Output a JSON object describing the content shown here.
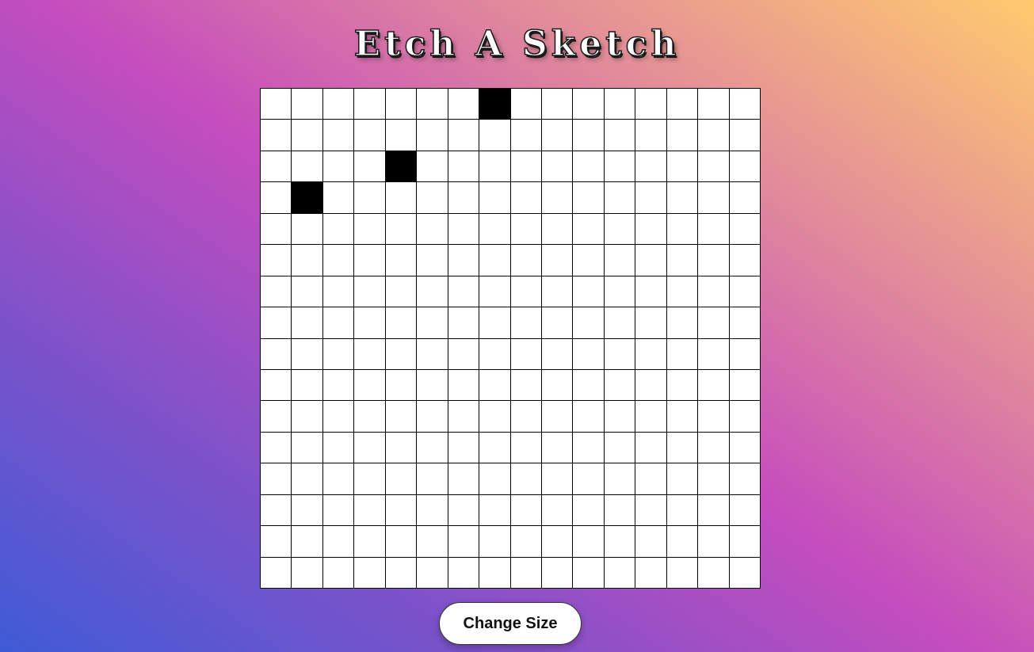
{
  "app": {
    "title": "Etch A Sketch"
  },
  "grid": {
    "rows": 16,
    "cols": 16,
    "filled_cells": [
      {
        "row": 0,
        "col": 7
      },
      {
        "row": 2,
        "col": 4
      },
      {
        "row": 3,
        "col": 1
      }
    ],
    "cell_color": "#ffffff",
    "ink_color": "#000000"
  },
  "controls": {
    "change_size_label": "Change Size"
  },
  "colors": {
    "gradient_bottom_left": "#3f5bd6",
    "gradient_middle": "#c54dbd",
    "gradient_top_right": "#ffca6e"
  }
}
